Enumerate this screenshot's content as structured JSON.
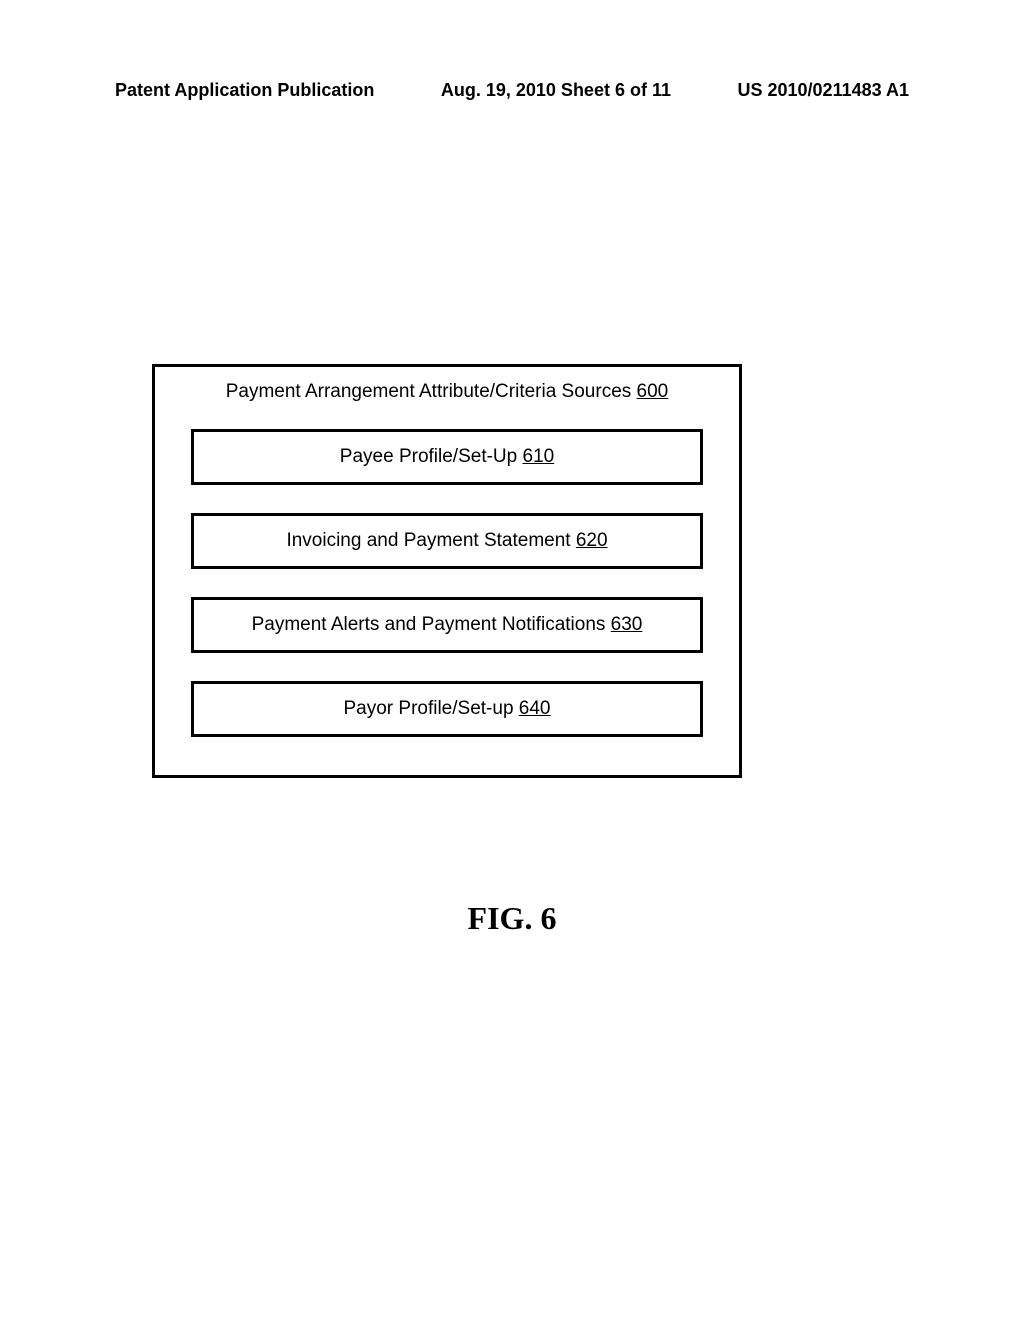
{
  "header": {
    "left": "Patent Application Publication",
    "center": "Aug. 19, 2010  Sheet 6 of 11",
    "right": "US 2010/0211483 A1"
  },
  "outerBox": {
    "title_text": "Payment Arrangement Attribute/Criteria Sources ",
    "title_ref": "600",
    "items": [
      {
        "text": "Payee Profile/Set-Up ",
        "ref": "610"
      },
      {
        "text": "Invoicing and Payment Statement ",
        "ref": "620"
      },
      {
        "text": "Payment Alerts and Payment Notifications ",
        "ref": "630"
      },
      {
        "text": "Payor Profile/Set-up  ",
        "ref": "640"
      }
    ]
  },
  "figure_caption": "FIG. 6"
}
